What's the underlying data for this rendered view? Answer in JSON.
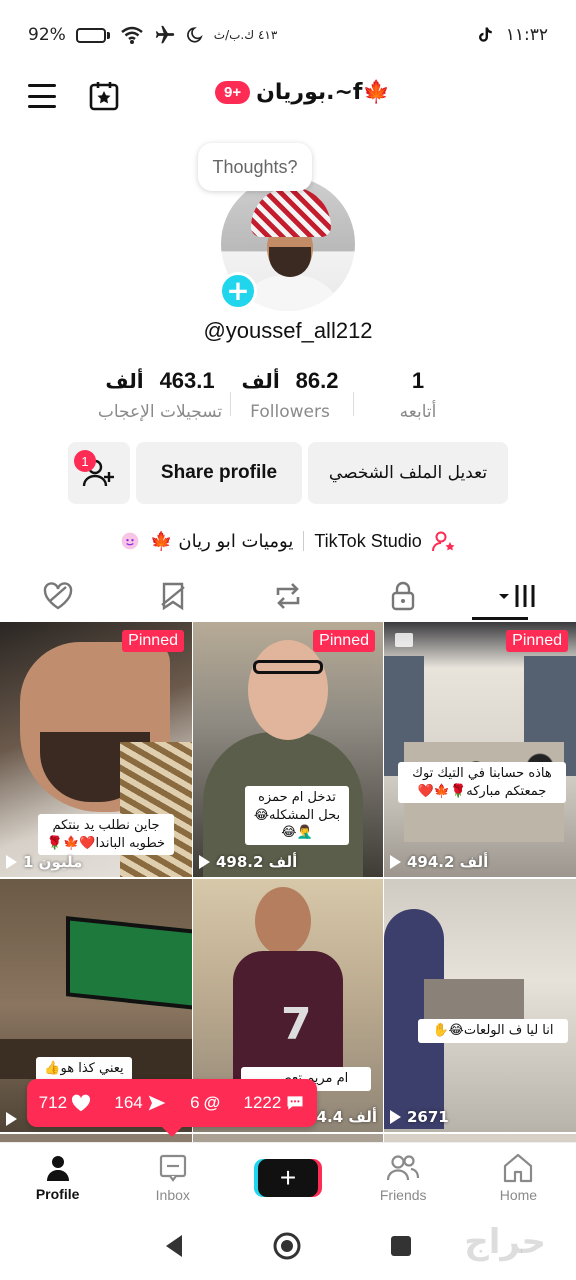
{
  "status_bar": {
    "battery_text": "92%",
    "time": "١١:٣٢",
    "network_text": "٤١٣ ك.ب/ث",
    "battery_level": 0.92,
    "battery_color": "#f2b600"
  },
  "header": {
    "notification_badge": "9+",
    "username": "بوريان.~f🍁",
    "icons": [
      "menu-icon",
      "calendar-star-icon"
    ]
  },
  "profile": {
    "thought_placeholder": "Thoughts?",
    "handle": "@youssef_all212",
    "add_avatar_symbol": "+"
  },
  "stats": [
    {
      "value": "1",
      "unit": "",
      "label": "أتابعه"
    },
    {
      "value": "86.2",
      "unit": "ألف",
      "label": "Followers"
    },
    {
      "value": "463.1",
      "unit": "ألف",
      "label": "تسجيلات الإعجاب"
    }
  ],
  "actions": {
    "edit_profile": "تعديل الملف الشخصي",
    "share_profile": "Share profile",
    "add_friends_badge": "1"
  },
  "links": {
    "studio": "TikTok Studio",
    "diary": "يوميات ابو ريان 🍁"
  },
  "tabs": [
    "videos-tab",
    "private-tab",
    "reposts-tab",
    "favorites-tab",
    "liked-tab"
  ],
  "videos": [
    {
      "pinned": "Pinned",
      "caption": "جاين نطلب يد بنتكم خطوبه الباندا❤️🍁🌹",
      "views": "1 مليون"
    },
    {
      "pinned": "Pinned",
      "caption": "تدخل ام حمزه بحل المشكله😂🤦‍♂️😂",
      "views": "498.2 ألف"
    },
    {
      "pinned": "Pinned",
      "caption": "هاذه حسابنا في التيك توك جمعتكم مباركه🌹🍁❤️",
      "views": "494.2 ألف"
    },
    {
      "caption": "يعني كذا هو👍",
      "views": ""
    },
    {
      "caption": "ام مريم تعص...",
      "views": "24.4 ألف"
    },
    {
      "caption": "انا ليا ف الولعات😂✋",
      "views": "2671"
    }
  ],
  "activity": {
    "comments": "1222",
    "mentions": "6",
    "shares": "164",
    "likes": "712"
  },
  "bottom_nav": {
    "profile": "Profile",
    "inbox": "Inbox",
    "friends": "Friends",
    "home": "Home"
  },
  "watermark": "حراج",
  "colors": {
    "accent": "#fe2c55",
    "cyan": "#20d5ec"
  }
}
